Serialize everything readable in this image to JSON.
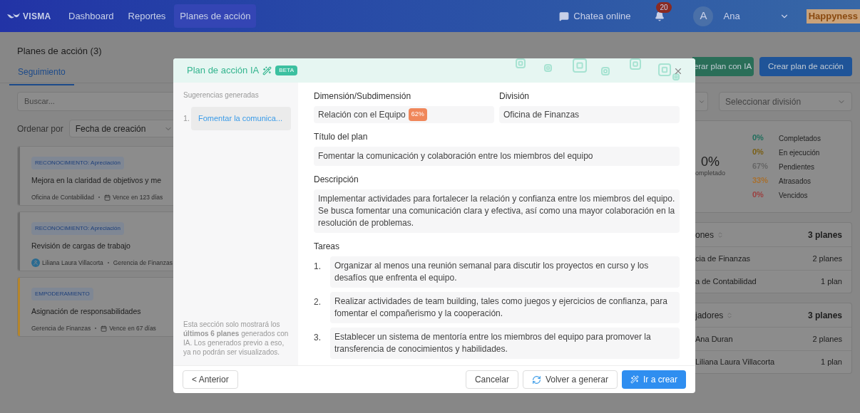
{
  "nav": {
    "logo": "VISMA",
    "links": [
      {
        "label": "Dashboard",
        "selected": false
      },
      {
        "label": "Reportes",
        "selected": false
      },
      {
        "label": "Planes de acción",
        "selected": true
      }
    ],
    "chat": "Chatea online",
    "notifications": "20",
    "avatar": "A",
    "user": "Ana",
    "brand": "Happyness"
  },
  "page": {
    "title": "Planes de acción (3)",
    "tabs": [
      {
        "label": "Seguimiento",
        "selected": true
      }
    ],
    "buttons": [
      {
        "label": "erar plan con IA",
        "kind": "secondary"
      },
      {
        "label": "Crear plan de acción",
        "kind": "primary"
      }
    ]
  },
  "filters": {
    "search_placeholder": "Buscar...",
    "sort_label": "Ordenar por",
    "sort_value": "Fecha de creación",
    "division_placeholder": "Seleccionar división"
  },
  "plans": [
    {
      "tag": "RECONOCIMIENTO: Apreciación",
      "title": "Mejora en la claridad de objetivos y me",
      "color": "#6b6b6b",
      "meta": [
        {
          "kind": "text",
          "text": "Oficina de Contabilidad"
        },
        {
          "kind": "date",
          "text": "Vence en 123 días"
        }
      ]
    },
    {
      "tag": "RECONOCIMIENTO: Apreciación",
      "title": "Revisión de cargas de trabajo",
      "color": "#6b6b6b",
      "meta": [
        {
          "kind": "person",
          "text": "Liliana Laura Villacorta"
        },
        {
          "kind": "text",
          "text": "Gerencia de Finanzas"
        }
      ]
    },
    {
      "tag": "EMPODERAMIENTO",
      "title": "Asignación de responsabilidades",
      "color": "#b5852a",
      "meta": [
        {
          "kind": "text",
          "text": "Gerencia de Finanzas"
        },
        {
          "kind": "date",
          "text": "Vence en 67 días"
        }
      ]
    }
  ],
  "summary": {
    "value": "0%",
    "caption": "ompletado",
    "legend": [
      {
        "value": "0%",
        "label": "Completados",
        "color": "#1f6e5c"
      },
      {
        "value": "0%",
        "label": "En ejecución",
        "color": "#7a5f14"
      },
      {
        "value": "67%",
        "label": "Pendientes",
        "color": "#666666"
      },
      {
        "value": "33%",
        "label": "Atrasados",
        "color": "#a8702e"
      },
      {
        "value": "0%",
        "label": "Vencidos",
        "color": "#9c4040"
      }
    ]
  },
  "groups": [
    {
      "title": "ones",
      "total": "3 planes",
      "rows": [
        {
          "name": "cia de Finanzas",
          "count": "2 planes"
        },
        {
          "name": "a de Contabilidad",
          "count": "1 plan"
        }
      ]
    },
    {
      "title": "jadores",
      "total": "3 planes",
      "rows": [
        {
          "name": "Ana Duran",
          "count": "2 planes"
        },
        {
          "name": "Liliana Laura Villacorta",
          "count": "1 plan"
        }
      ]
    }
  ],
  "modal": {
    "title": "Plan de acción IA",
    "badge": "BETA",
    "sidebar": {
      "heading": "Sugerencias generadas",
      "items": [
        {
          "number": "1.",
          "label": "Fomentar la comunica...",
          "selected": true
        }
      ],
      "note": "Esta sección solo mostrará los **últimos 6 planes** generados con IA. Los generados previo a eso, ya no podrán ser visualizados."
    },
    "dimension": {
      "label": "Dimensión/Subdimensión",
      "value": "Relación con el Equipo",
      "score": "62%"
    },
    "division": {
      "label": "División",
      "value": "Oficina de Finanzas"
    },
    "plan_title": {
      "label": "Título del plan",
      "value": "Fomentar la comunicación y colaboración entre los miembros del equipo"
    },
    "description": {
      "label": "Descripción",
      "value": "Implementar actividades para fortalecer la relación y confianza entre los miembros del equipo. Se busca fomentar una comunicación clara y efectiva, así como una mayor colaboración en la resolución de problemas."
    },
    "tasks": {
      "label": "Tareas",
      "items": [
        {
          "number": "1.",
          "text": "Organizar al menos una reunión semanal para discutir los proyectos en curso y los desafíos que enfrenta el equipo."
        },
        {
          "number": "2.",
          "text": "Realizar actividades de team building, tales como juegos y ejercicios de confianza, para fomentar el compañerismo y la cooperación."
        },
        {
          "number": "3.",
          "text": "Establecer un sistema de mentoría entre los miembros del equipo para promover la transferencia de conocimientos y habilidades."
        }
      ]
    },
    "footer": {
      "back": "< Anterior",
      "cancel": "Cancelar",
      "regenerate": "Volver a generar",
      "create": "Ir a crear"
    }
  }
}
